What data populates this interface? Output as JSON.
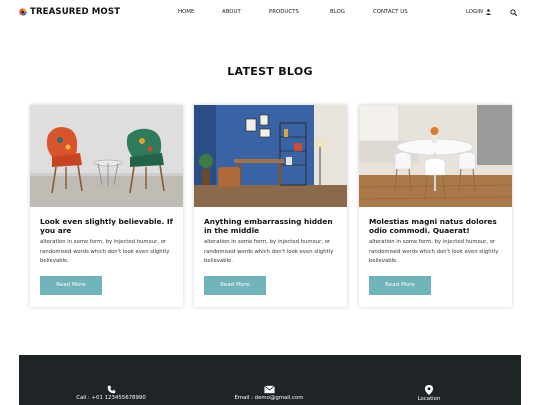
{
  "header": {
    "logo_text": "TREASURED MOST",
    "nav": [
      "HOME",
      "ABOUT",
      "PRODUCTS",
      "BLOG",
      "CONTACT US"
    ],
    "login_label": "LOGIN",
    "icons": {
      "logo": "logo-icon",
      "user": "user-icon",
      "search": "search-icon"
    }
  },
  "section": {
    "title": "LATEST BLOG"
  },
  "cards": [
    {
      "title": "Look even slightly believable. If you are",
      "text": "alteration in some form, by injected humour, or randomised words which don't look even slightly believable.",
      "button": "Read More",
      "image": "orange-and-green-patterned-chairs-photo"
    },
    {
      "title": "Anything embarrassing hidden in the middle",
      "text": "alteration in some form, by injected humour, or randomised words which don't look even slightly believable.",
      "button": "Read More",
      "image": "blue-wall-living-room-photo"
    },
    {
      "title": "Molestias magni natus dolores odio commodi. Quaerat!",
      "text": "alteration in some form, by injected humour, or randomised words which don't look even slightly believable.",
      "button": "Read More",
      "image": "white-dining-table-kitchen-photo"
    }
  ],
  "footer": {
    "call": "Call : +01 123455678990",
    "email": "Email : demo@gmail.com",
    "location": "Location"
  },
  "colors": {
    "button_bg": "#6fb3bb",
    "footer_bg": "#1f2426",
    "text": "#111111"
  }
}
